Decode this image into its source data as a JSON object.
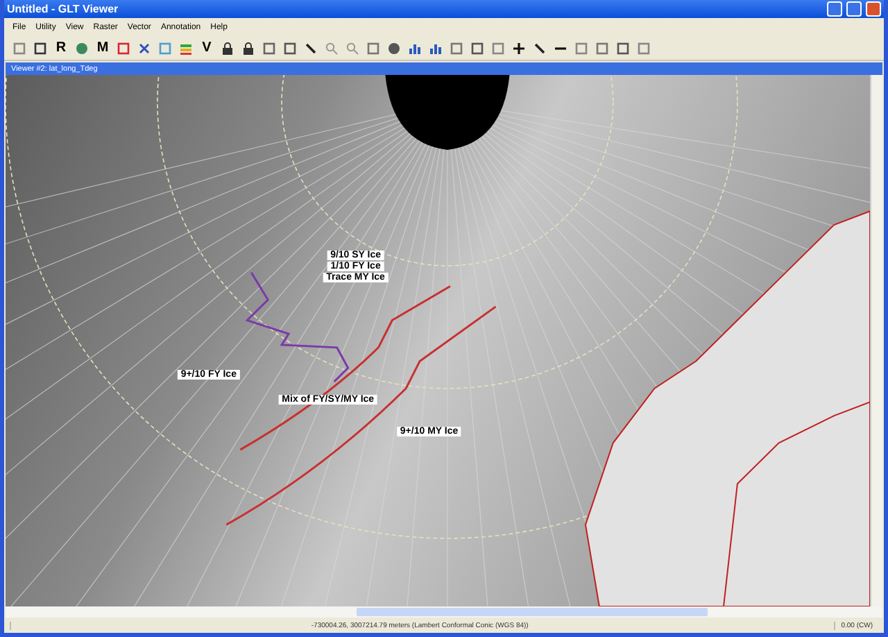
{
  "window": {
    "title": "Untitled - GLT Viewer"
  },
  "menu": [
    "File",
    "Utility",
    "View",
    "Raster",
    "Vector",
    "Annotation",
    "Help"
  ],
  "toolbar": [
    {
      "kind": "icon"
    },
    {
      "kind": "icon"
    },
    {
      "kind": "letter",
      "text": "R"
    },
    {
      "kind": "icon"
    },
    {
      "kind": "letter",
      "text": "M"
    },
    {
      "kind": "icon"
    },
    {
      "kind": "icon"
    },
    {
      "kind": "icon"
    },
    {
      "kind": "icon"
    },
    {
      "kind": "letter",
      "text": "V"
    },
    {
      "kind": "icon"
    },
    {
      "kind": "icon"
    },
    {
      "kind": "icon"
    },
    {
      "kind": "icon"
    },
    {
      "kind": "icon"
    },
    {
      "kind": "icon"
    },
    {
      "kind": "icon"
    },
    {
      "kind": "icon"
    },
    {
      "kind": "icon"
    },
    {
      "kind": "icon"
    },
    {
      "kind": "icon"
    },
    {
      "kind": "icon"
    },
    {
      "kind": "icon"
    },
    {
      "kind": "icon"
    },
    {
      "kind": "icon"
    },
    {
      "kind": "icon"
    },
    {
      "kind": "icon"
    },
    {
      "kind": "icon"
    },
    {
      "kind": "icon"
    },
    {
      "kind": "icon"
    },
    {
      "kind": "icon"
    }
  ],
  "viewer": {
    "title": "Viewer #2: lat_long_Tdeg",
    "labels": [
      {
        "lines": [
          "9/10 SY Ice",
          "1/10 FY Ice",
          "Trace MY Ice"
        ]
      },
      {
        "lines": [
          "9+/10 FY Ice"
        ]
      },
      {
        "lines": [
          "Mix of FY/SY/MY Ice"
        ]
      },
      {
        "lines": [
          "9+/10 MY Ice"
        ]
      }
    ]
  },
  "status_bar": {
    "coordinates": "-730004.26, 3007214.79 meters (Lambert Conformal Conic (WGS 84))",
    "rotation": "0.00 (CW)"
  }
}
